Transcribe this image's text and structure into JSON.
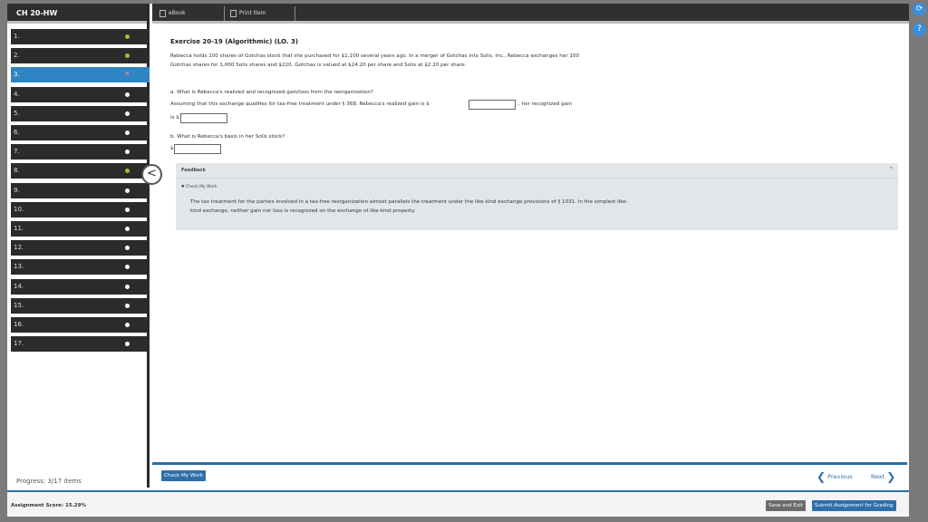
{
  "sidebar": {
    "title": "CH 20-HW",
    "items": [
      {
        "label": "1.",
        "status": "done"
      },
      {
        "label": "2.",
        "status": "done"
      },
      {
        "label": "3.",
        "status": "wrong"
      },
      {
        "label": "4.",
        "status": "open"
      },
      {
        "label": "5.",
        "status": "open"
      },
      {
        "label": "6.",
        "status": "open"
      },
      {
        "label": "7.",
        "status": "open"
      },
      {
        "label": "8.",
        "status": "done"
      },
      {
        "label": "9.",
        "status": "open"
      },
      {
        "label": "10.",
        "status": "open"
      },
      {
        "label": "11.",
        "status": "open"
      },
      {
        "label": "12.",
        "status": "open"
      },
      {
        "label": "13.",
        "status": "open"
      },
      {
        "label": "14.",
        "status": "open"
      },
      {
        "label": "15.",
        "status": "open"
      },
      {
        "label": "16.",
        "status": "open"
      },
      {
        "label": "17.",
        "status": "open"
      }
    ],
    "active_index": 2,
    "wrong_mark": "✕",
    "progress": "Progress: 3/17 items"
  },
  "toolbar": {
    "ebook_label": "eBook",
    "print_label": "Print Item"
  },
  "exercise": {
    "title": "Exercise 20-19 (Algorithmic) (LO. 3)",
    "intro": "Rebecca holds 100 shares of Gotchas stock that she purchased for $1,100 several years ago. In a merger of Gotchas into Solis, Inc., Rebecca exchanges her 100 Gotchas shares for 1,000 Solis shares and $220. Gotchas is valued at $24.20 per share and Solis at $2.20 per share.",
    "q_a": "a.  What is Rebecca's realized and recognized gain/loss from the reorganization?",
    "q_a_line": "Assuming that this exchange qualifies for tax-free treatment under § 368, Rebecca's realized gain is $",
    "q_a_tail": ", her recognized gain",
    "q_a_is": "is $",
    "q_a_period": ".",
    "q_b": "b.  What is Rebecca's basis in her Solis stock?",
    "q_b_dollar": "$"
  },
  "feedback": {
    "heading": "Feedback",
    "check": "▼ Check My Work",
    "text": "The tax treatment for the parties involved in a tax-free reorganization almost parallels the treatment under the like-kind exchange provisions of § 1031. In the simplest like-kind exchange, neither gain nor loss is recognized on the exchange of like-kind property."
  },
  "nav": {
    "check_my_work": "Check My Work",
    "previous": "Previous",
    "next": "Next",
    "back_arrow": "<"
  },
  "footer": {
    "score": "Assignment Score: 15.29%",
    "save_exit": "Save and Exit",
    "submit": "Submit Assignment for Grading"
  },
  "side_buttons": {
    "refresh": "⟳",
    "help": "?"
  }
}
